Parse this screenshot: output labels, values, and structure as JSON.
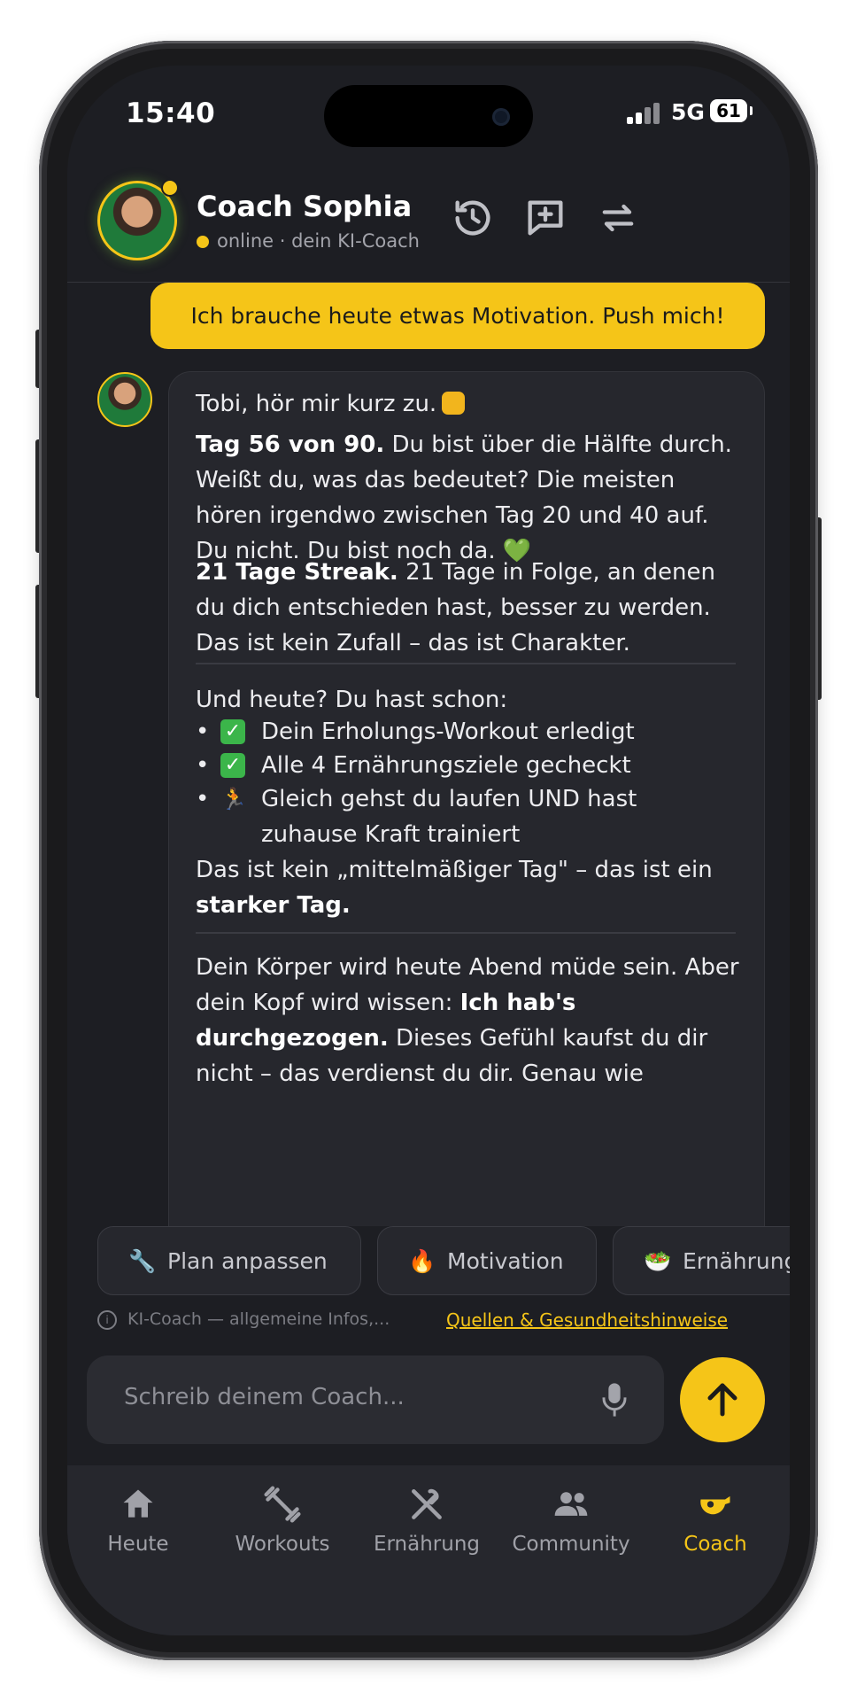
{
  "status_bar": {
    "time": "15:40",
    "network": "5G",
    "battery": "61"
  },
  "header": {
    "name": "Coach Sophia",
    "status": "online · dein KI-Coach",
    "icons": [
      "history-icon",
      "new-chat-icon",
      "swap-icon"
    ]
  },
  "chat": {
    "user_message": "Ich brauche heute etwas Motivation. Push mich!",
    "coach": {
      "greeting": "Tobi, hör mir kurz zu.",
      "p1_bold": "Tag 56 von 90.",
      "p1_text": "Du bist über die Hälfte durch. Weißt du, was das bedeutet? Die meisten hören irgendwo zwischen Tag 20 und 40 auf. Du nicht. Du bist noch da.",
      "p1_emoji": "💚",
      "p2_bold": "21 Tage Streak.",
      "p2_text": "21 Tage in Folge, an denen du dich entschieden hast, besser zu werden. Das ist kein Zufall – das ist Charakter.",
      "p3_intro": "Und heute? Du hast schon:",
      "checklist": [
        {
          "icon": "check-icon",
          "text": "Dein Erholungs-Workout erledigt"
        },
        {
          "icon": "check-icon",
          "text": "Alle 4 Ernährungsziele gecheckt"
        },
        {
          "icon": "runner-icon",
          "text": "Gleich gehst du laufen UND hast zuhause Kraft trainiert"
        }
      ],
      "p4_text": "Das ist kein „mittelmäßiger Tag\" – das ist ein",
      "p4_bold": "starker Tag.",
      "p5_text_a": "Dein Körper wird heute Abend müde sein. Aber dein Kopf wird wissen:",
      "p5_bold": "Ich hab's durchgezogen.",
      "p5_text_b": "Dieses Gefühl kaufst du dir nicht – das verdienst du dir. Genau wie"
    }
  },
  "chips": [
    {
      "icon": "🔧",
      "label": "Plan anpassen"
    },
    {
      "icon": "🔥",
      "label": "Motivation"
    },
    {
      "icon": "🥗",
      "label": "Ernährung"
    }
  ],
  "disclaimer": {
    "text": "KI-Coach — allgemeine Infos,...",
    "link": "Quellen & Gesundheitshinweise"
  },
  "composer": {
    "placeholder": "Schreib deinem Coach..."
  },
  "tabs": [
    {
      "label": "Heute",
      "icon": "home-icon",
      "active": false
    },
    {
      "label": "Workouts",
      "icon": "dumbbell-icon",
      "active": false
    },
    {
      "label": "Ernährung",
      "icon": "utensils-icon",
      "active": false
    },
    {
      "label": "Community",
      "icon": "people-icon",
      "active": false
    },
    {
      "label": "Coach",
      "icon": "whistle-icon",
      "active": true
    }
  ],
  "colors": {
    "accent": "#f5c518",
    "background": "#1d1e23",
    "card": "#26272d"
  }
}
